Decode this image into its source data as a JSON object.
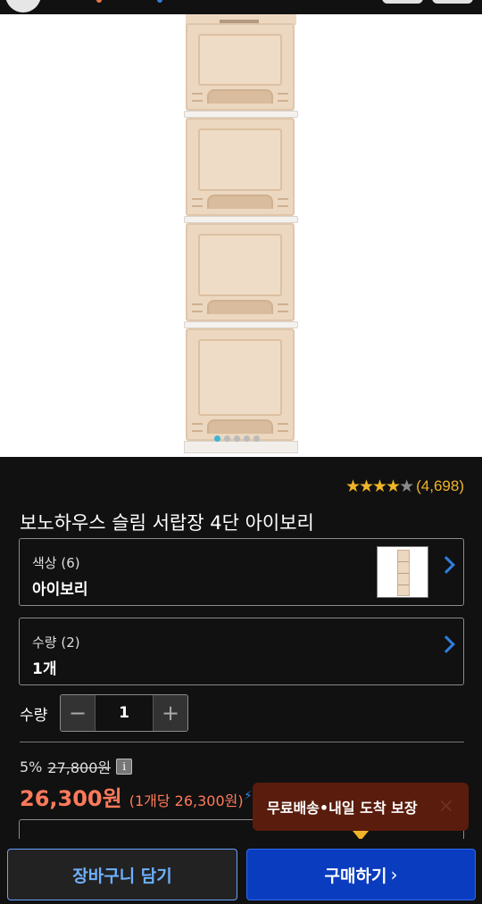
{
  "product": {
    "title": "보노하우스 슬림 서랍장 4단 아이보리",
    "image_dots": 5,
    "image_dot_active_index": 0
  },
  "rating": {
    "stars": 4.5,
    "count_text": "(4,698)"
  },
  "options": {
    "color": {
      "label": "색상 (6)",
      "value": "아이보리",
      "thumbnail": "ivory-drawer-thumbnail"
    },
    "quantity": {
      "label": "수량 (2)",
      "value": "1개"
    }
  },
  "stepper": {
    "label": "수량",
    "value": "1",
    "minus": "−",
    "plus": "+"
  },
  "pricing": {
    "discount_rate": "5%",
    "original_price": "27,800원",
    "info_icon": "i",
    "sale_price": "26,300원",
    "unit_price": "(1개당 26,300원)"
  },
  "tooltip": {
    "text": "무료배송•내일 도착 보장",
    "close": "×"
  },
  "actions": {
    "cart_label": "장바구니 담기",
    "buy_label": "구매하기",
    "buy_chevron": "›"
  },
  "colors": {
    "accent_blue": "#0a3cbf",
    "star": "#f0b429",
    "price": "#ff7a5a",
    "tooltip_bg": "#5a1c0c"
  }
}
